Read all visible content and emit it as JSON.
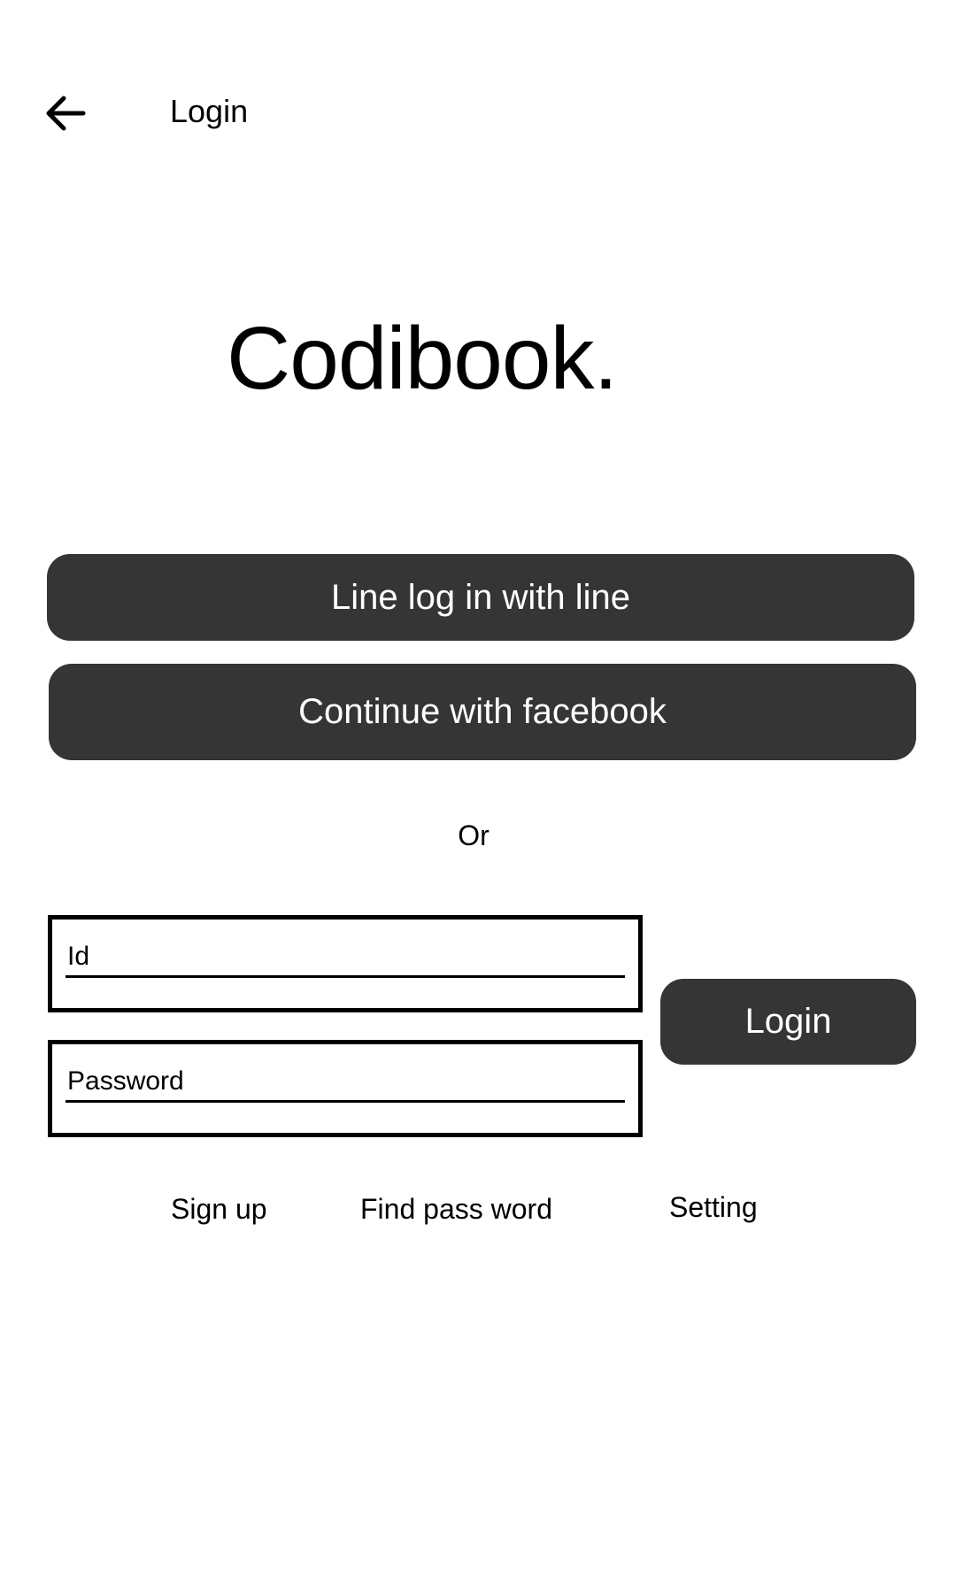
{
  "app_bar": {
    "back_icon": "arrow-left-icon",
    "title": "Login"
  },
  "brand": {
    "name": "Codibook."
  },
  "social": {
    "line_label": "Line log in with line",
    "facebook_label": "Continue with facebook"
  },
  "divider": {
    "label": "Or"
  },
  "form": {
    "id_placeholder": "Id",
    "password_placeholder": "Password",
    "login_label": "Login"
  },
  "links": {
    "sign_up": "Sign up",
    "find_password": "Find pass word",
    "setting": "Setting"
  },
  "colors": {
    "button_background": "#353535",
    "button_text": "#ffffff",
    "text": "#000000",
    "background": "#ffffff"
  }
}
